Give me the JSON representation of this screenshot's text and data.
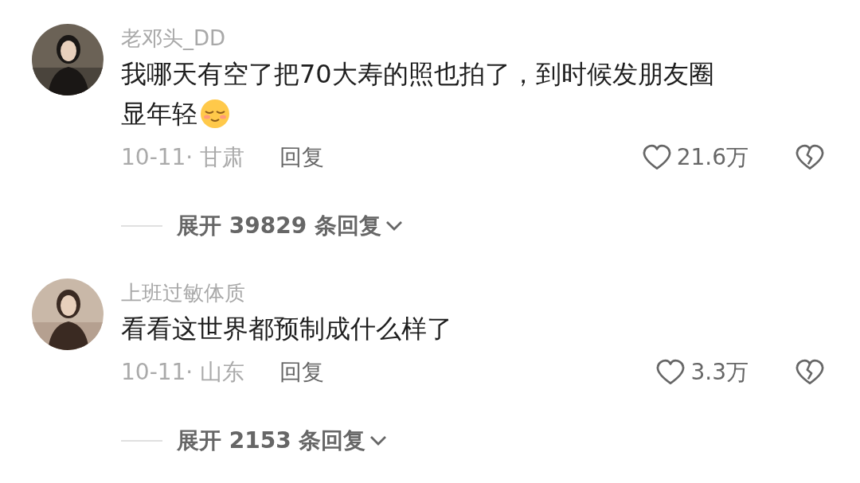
{
  "comments": [
    {
      "avatar": {
        "kind": "picture"
      },
      "username": "老邓头_DD",
      "text_lines": [
        "我哪天有空了把70大寿的照也拍了，到时候发朋友圈",
        "显年轻"
      ],
      "has_emoji": true,
      "date": "10-11· 甘肃",
      "reply": "回复",
      "likes": "21.6万",
      "expand": "展开 39829 条回复"
    },
    {
      "avatar": {
        "kind": "picture"
      },
      "username": "上班过敏体质",
      "text_lines": [
        "看看这世界都预制成什么样了"
      ],
      "date": "10-11· 山东",
      "reply": "回复",
      "likes": "3.3万",
      "expand": "展开 2153 条回复"
    }
  ]
}
